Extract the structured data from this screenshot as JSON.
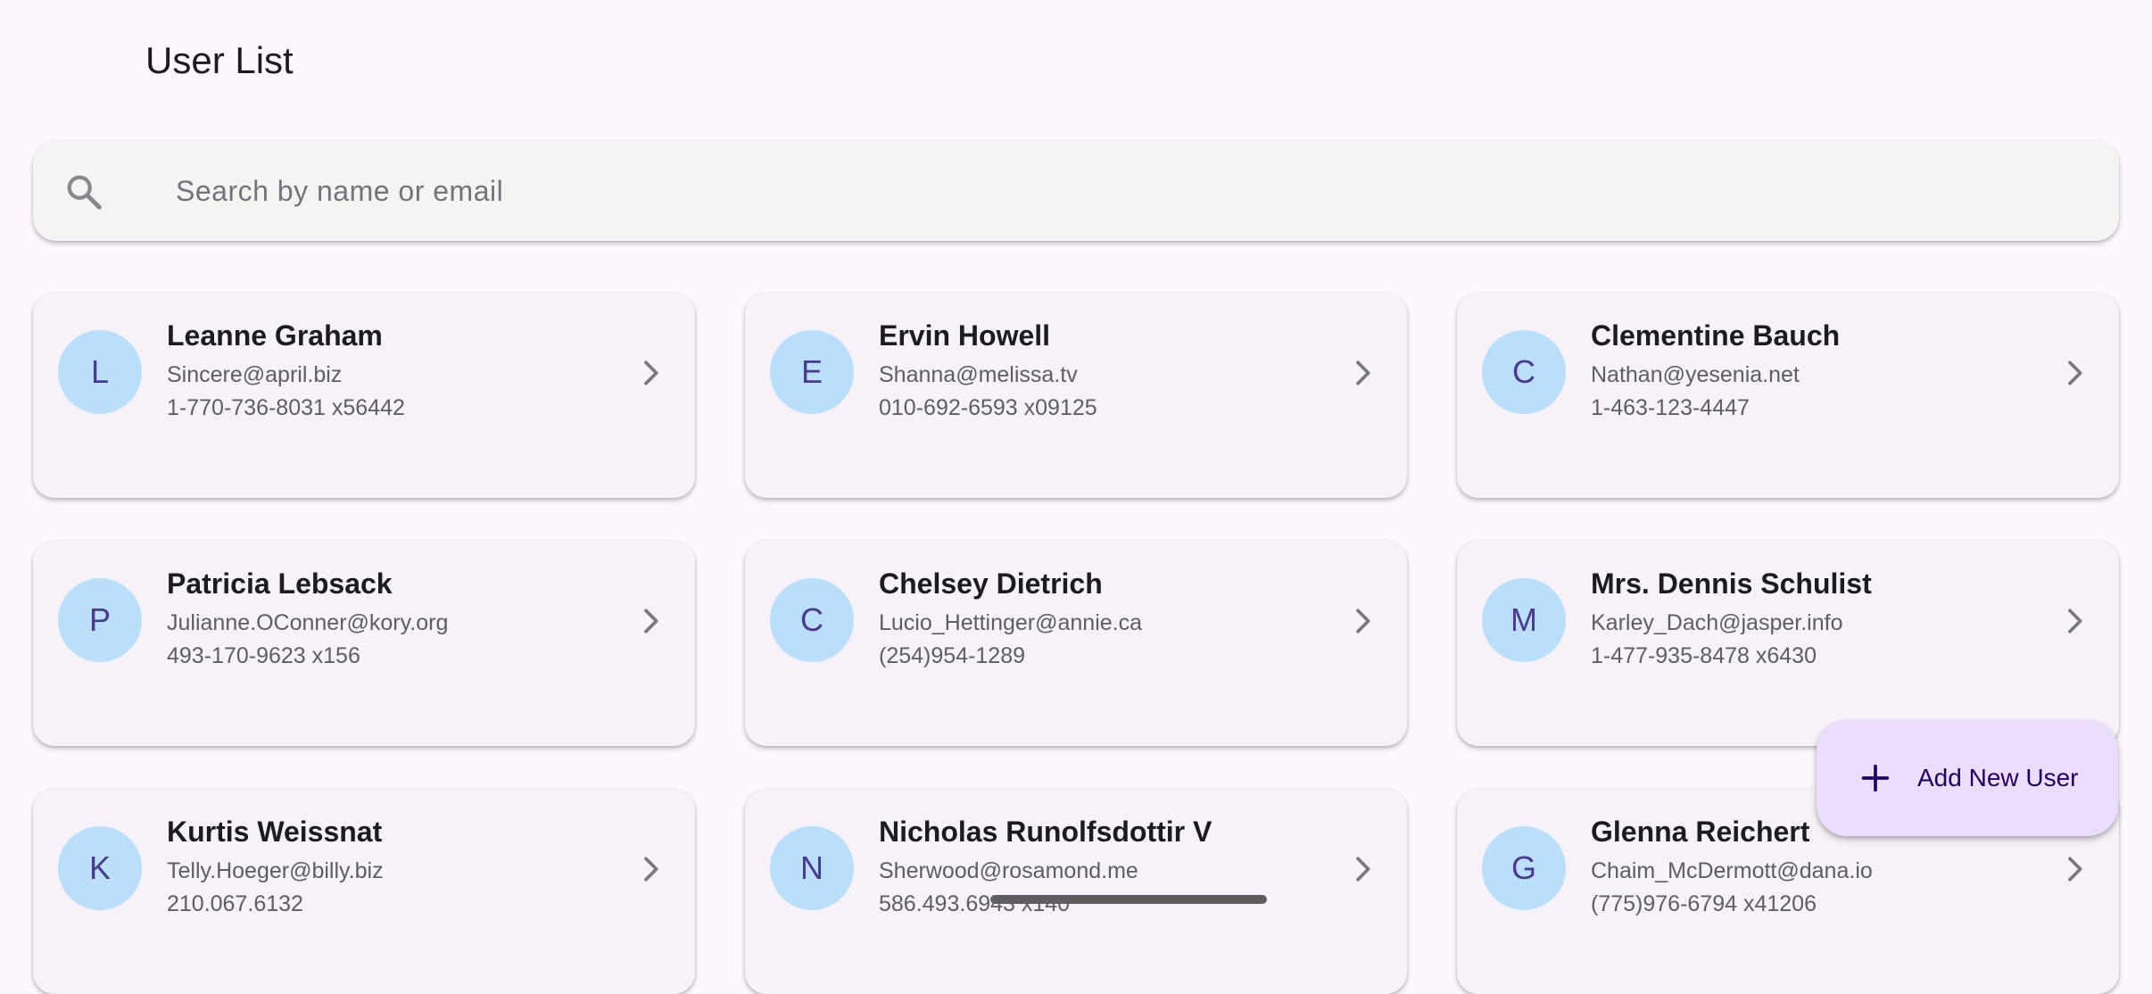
{
  "header": {
    "title": "User List"
  },
  "search": {
    "icon": "search-icon",
    "placeholder": "Search by name or email",
    "value": ""
  },
  "users": [
    {
      "initial": "L",
      "name": "Leanne Graham",
      "email": "Sincere@april.biz",
      "phone": "1-770-736-8031 x56442"
    },
    {
      "initial": "E",
      "name": "Ervin Howell",
      "email": "Shanna@melissa.tv",
      "phone": "010-692-6593 x09125"
    },
    {
      "initial": "C",
      "name": "Clementine Bauch",
      "email": "Nathan@yesenia.net",
      "phone": "1-463-123-4447"
    },
    {
      "initial": "P",
      "name": "Patricia Lebsack",
      "email": "Julianne.OConner@kory.org",
      "phone": "493-170-9623 x156"
    },
    {
      "initial": "C",
      "name": "Chelsey Dietrich",
      "email": "Lucio_Hettinger@annie.ca",
      "phone": "(254)954-1289"
    },
    {
      "initial": "M",
      "name": "Mrs. Dennis Schulist",
      "email": "Karley_Dach@jasper.info",
      "phone": "1-477-935-8478 x6430"
    },
    {
      "initial": "K",
      "name": "Kurtis Weissnat",
      "email": "Telly.Hoeger@billy.biz",
      "phone": "210.067.6132"
    },
    {
      "initial": "N",
      "name": "Nicholas Runolfsdottir V",
      "email": "Sherwood@rosamond.me",
      "phone": "586.493.6943 x140"
    },
    {
      "initial": "G",
      "name": "Glenna Reichert",
      "email": "Chaim_McDermott@dana.io",
      "phone": "(775)976-6794 x41206"
    }
  ],
  "fab": {
    "icon": "plus-icon",
    "label": "Add New User"
  },
  "colors": {
    "background": "#fef7ff",
    "card": "#f7f2fa",
    "avatar": "#bbdefb",
    "avatar_text": "#4a3a8c",
    "fab": "#eaddff",
    "search_bar": "#f4f4f2"
  }
}
